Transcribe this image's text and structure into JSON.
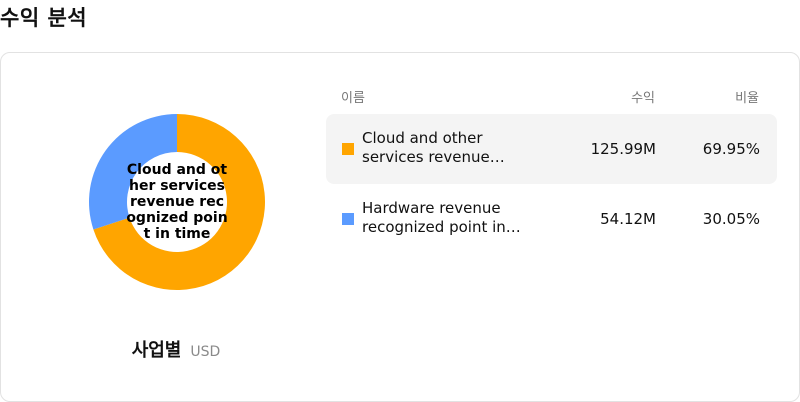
{
  "page": {
    "title": "수익 분석"
  },
  "chart": {
    "center_text": "Cloud and other services revenue recognized point in time",
    "caption_title": "사업별",
    "caption_unit": "USD"
  },
  "table": {
    "headers": {
      "name": "이름",
      "revenue": "수익",
      "share": "비율"
    },
    "rows": [
      {
        "name": "Cloud and other services revenue…",
        "revenue": "125.99M",
        "share": "69.95%",
        "color": "#FFA500"
      },
      {
        "name": "Hardware revenue recognized point in…",
        "revenue": "54.12M",
        "share": "30.05%",
        "color": "#5B9BFF"
      }
    ]
  },
  "chart_data": {
    "type": "pie",
    "categories": [
      "Cloud and other services revenue recognized point in time",
      "Hardware revenue recognized point in time"
    ],
    "values": [
      125.99,
      54.12
    ],
    "percent": [
      69.95,
      30.05
    ],
    "unit": "USD",
    "colors": [
      "#FFA500",
      "#5B9BFF"
    ]
  }
}
